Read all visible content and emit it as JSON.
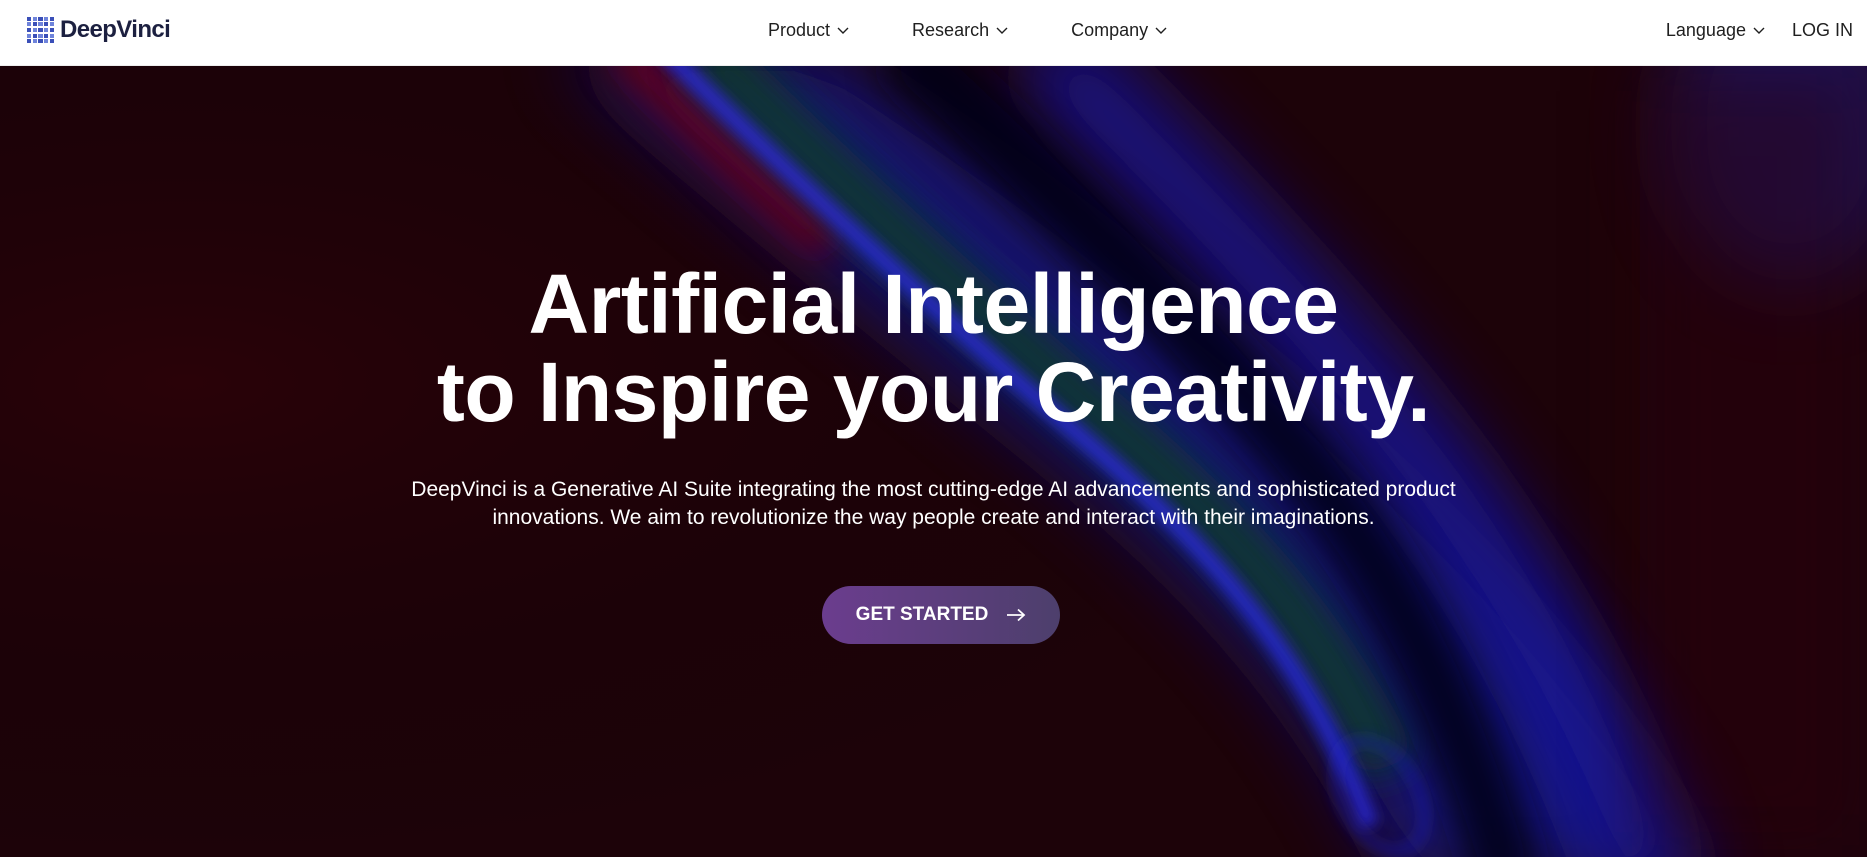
{
  "brand": {
    "name": "DeepVinci",
    "logo_color": "#3a4fb8"
  },
  "nav": {
    "items": [
      {
        "label": "Product",
        "icon": "chevron-down-icon"
      },
      {
        "label": "Research",
        "icon": "chevron-down-icon"
      },
      {
        "label": "Company",
        "icon": "chevron-down-icon"
      }
    ],
    "language_label": "Language",
    "login_label": "LOG IN"
  },
  "hero": {
    "title_line1": "Artificial Intelligence",
    "title_line2": "to Inspire your Creativity.",
    "subtitle_line1": "DeepVinci is a Generative AI Suite integrating the most cutting-edge AI advancements and sophisticated product",
    "subtitle_line2": "innovations. We aim to revolutionize the way people create and interact with their imaginations.",
    "cta_label": "GET STARTED",
    "cta_icon": "arrow-right-icon",
    "colors": {
      "base": "#1a0308",
      "accent_blue": "#1a1ab0",
      "accent_red": "#5a0010",
      "cta_start": "#6b3d8e",
      "cta_end": "#4d3f6c"
    }
  }
}
